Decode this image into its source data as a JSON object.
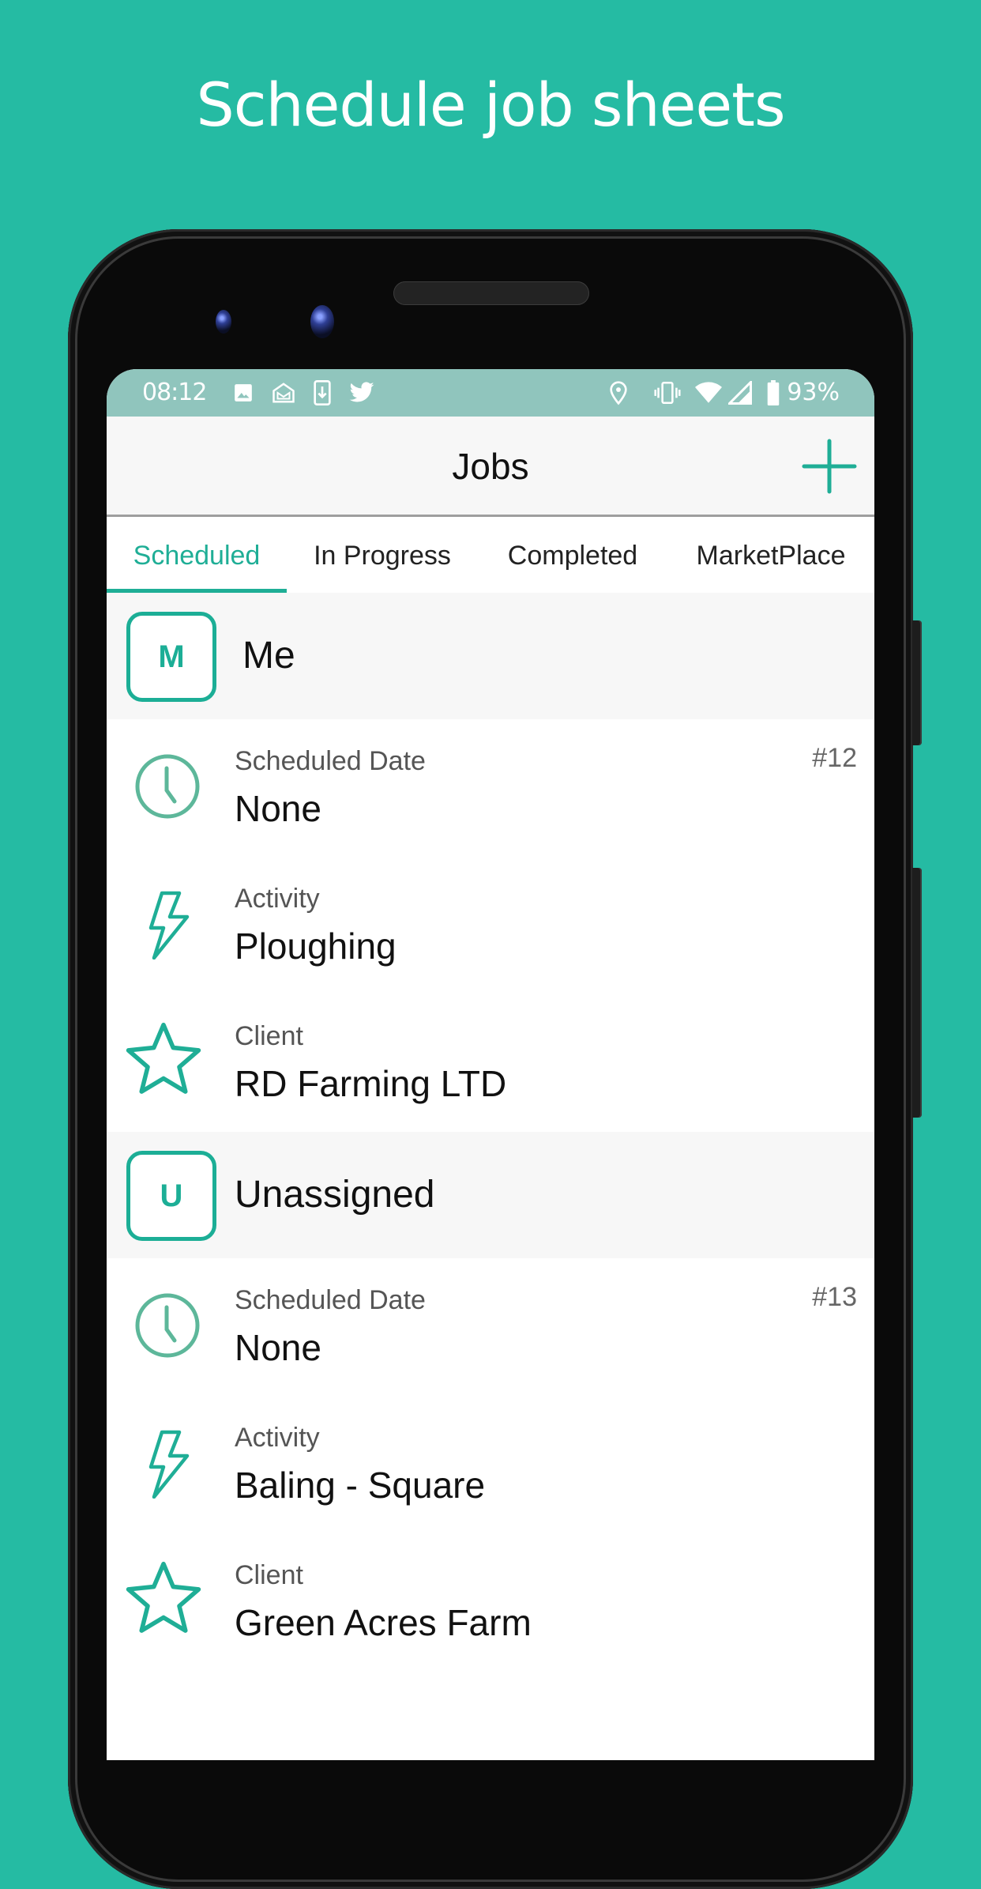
{
  "promo": {
    "title": "Schedule job sheets"
  },
  "colors": {
    "background": "#25bba3",
    "accent": "#1fae96",
    "status_bar": "#90c5bd",
    "clock_icon": "#5db79a"
  },
  "status_bar": {
    "time": "08:12",
    "left_icons": [
      "image-icon",
      "email-icon",
      "download-icon",
      "twitter-icon"
    ],
    "right_icons": [
      "location-icon",
      "vibrate-icon",
      "wifi-icon",
      "signal-icon",
      "battery-icon"
    ],
    "battery": "93%"
  },
  "app_bar": {
    "title": "Jobs",
    "add_button": "add-icon"
  },
  "tabs": [
    {
      "label": "Scheduled",
      "active": true
    },
    {
      "label": "In Progress",
      "active": false
    },
    {
      "label": "Completed",
      "active": false
    },
    {
      "label": "MarketPlace",
      "active": false
    }
  ],
  "groups": [
    {
      "initial": "M",
      "name": "Me",
      "job": {
        "number": "#12",
        "fields": [
          {
            "icon": "clock-icon",
            "label": "Scheduled Date",
            "value": "None"
          },
          {
            "icon": "lightning-icon",
            "label": "Activity",
            "value": "Ploughing"
          },
          {
            "icon": "star-icon",
            "label": "Client",
            "value": "RD Farming LTD"
          }
        ]
      }
    },
    {
      "initial": "U",
      "name": "Unassigned",
      "job": {
        "number": "#13",
        "fields": [
          {
            "icon": "clock-icon",
            "label": "Scheduled Date",
            "value": "None"
          },
          {
            "icon": "lightning-icon",
            "label": "Activity",
            "value": "Baling - Square"
          },
          {
            "icon": "star-icon",
            "label": "Client",
            "value": "Green Acres Farm"
          }
        ]
      }
    }
  ]
}
